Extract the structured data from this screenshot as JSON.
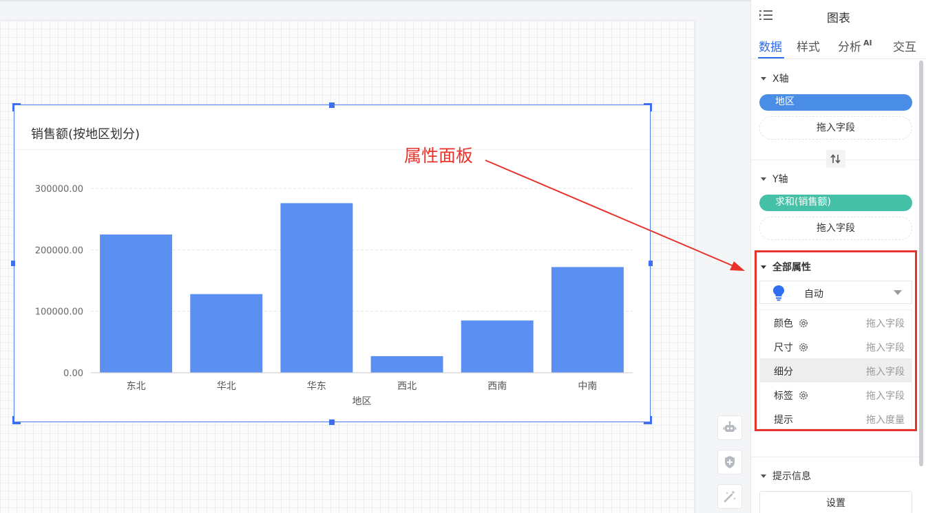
{
  "chart_widget": {
    "title": "销售额(按地区划分)",
    "accent_color": "#4a7cf0",
    "bar_color": "#5b8ff2"
  },
  "chart_data": {
    "type": "bar",
    "categories": [
      "东北",
      "华北",
      "华东",
      "西北",
      "西南",
      "中南"
    ],
    "values": [
      225000,
      128000,
      276000,
      27000,
      85000,
      172000
    ],
    "title": "销售额(按地区划分)",
    "xlabel": "地区",
    "ylabel": "",
    "ylim": [
      0,
      300000
    ],
    "yticks": [
      "0.00",
      "100000.00",
      "200000.00",
      "300000.00"
    ],
    "grid": true,
    "legend": "none"
  },
  "annotation": {
    "text": "属性面板",
    "color": "#e8322c"
  },
  "tools": {
    "robot_icon": "robot-icon",
    "shield_icon": "shield-plus-icon",
    "magic_icon": "magic-wand-icon"
  },
  "panel": {
    "title": "图表",
    "tabs": [
      {
        "label": "数据",
        "active": true
      },
      {
        "label": "样式",
        "active": false
      },
      {
        "label": "分析",
        "sup": "AI",
        "active": false
      },
      {
        "label": "交互",
        "active": false
      }
    ],
    "x_axis": {
      "label": "X轴",
      "field": "地区",
      "field_color": "#4a8de6",
      "drop_label": "拖入字段"
    },
    "y_axis": {
      "label": "Y轴",
      "field": "求和(销售额)",
      "field_color": "#45c1a8",
      "drop_label": "拖入字段"
    },
    "all_props": {
      "label": "全部属性",
      "mode": "自动",
      "rows": [
        {
          "name": "颜色",
          "gear": true,
          "drop": "拖入字段",
          "highlight": false
        },
        {
          "name": "尺寸",
          "gear": true,
          "drop": "拖入字段",
          "highlight": false
        },
        {
          "name": "细分",
          "gear": false,
          "drop": "拖入字段",
          "highlight": true
        },
        {
          "name": "标签",
          "gear": true,
          "drop": "拖入字段",
          "highlight": false
        },
        {
          "name": "提示",
          "gear": false,
          "drop": "拖入度量",
          "highlight": false
        }
      ]
    },
    "tooltip_info": {
      "label": "提示信息",
      "button": "设置"
    }
  }
}
